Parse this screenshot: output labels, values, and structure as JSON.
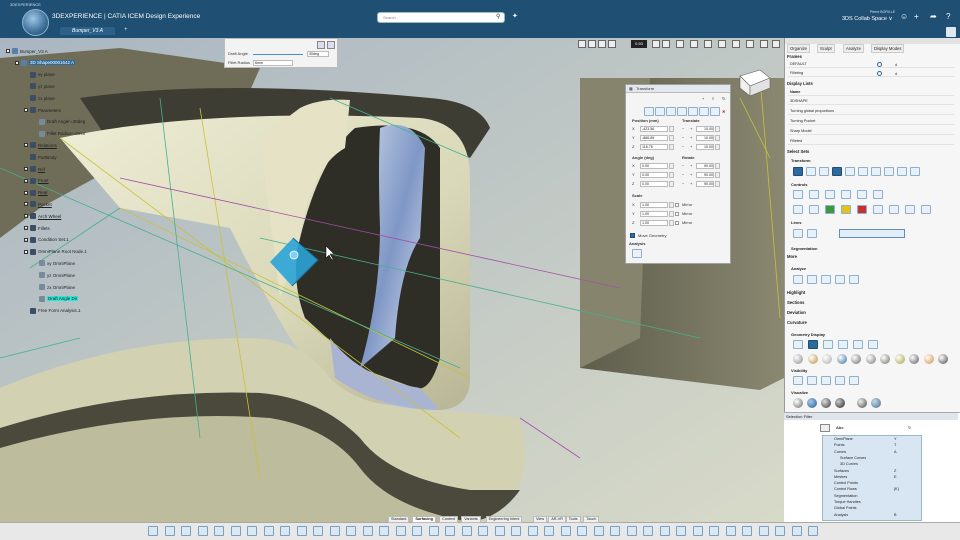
{
  "window": {
    "caption": "3DEXPERIENCE",
    "app_title": "3DEXPERIENCE | CATIA  ICEM Design Experience",
    "tab": "Bumper_V3 A",
    "new_tab": "+"
  },
  "search": {
    "placeholder": "Search"
  },
  "user": {
    "name": "Pierre BORILLE",
    "space": "3DS Collab Space ∨"
  },
  "tree": [
    {
      "label": "Bumper_V3 A",
      "indent": 0,
      "expand": "-"
    },
    {
      "label": "3D Shape00001642 A",
      "indent": 1,
      "expand": "-",
      "selected": true
    },
    {
      "label": "xy plane",
      "indent": 2
    },
    {
      "label": "yz plane",
      "indent": 2
    },
    {
      "label": "zx plane",
      "indent": 2
    },
    {
      "label": "Parameters",
      "indent": 2,
      "expand": "-"
    },
    {
      "label": "Draft Angle'=30deg",
      "indent": 3
    },
    {
      "label": "Fillet Radius'=6mm",
      "indent": 3
    },
    {
      "label": "Relations",
      "indent": 2,
      "expand": "+"
    },
    {
      "label": "PartBody",
      "indent": 2
    },
    {
      "label": "Ref",
      "indent": 2,
      "expand": "+"
    },
    {
      "label": "Front",
      "indent": 2,
      "expand": "+"
    },
    {
      "label": "Rear",
      "indent": 2,
      "expand": "+"
    },
    {
      "label": "Pocket",
      "indent": 2,
      "expand": "+"
    },
    {
      "label": "Arch Wheel",
      "indent": 2,
      "expand": "+"
    },
    {
      "label": "Fillets",
      "indent": 2,
      "expand": "+"
    },
    {
      "label": "Condition Set.1",
      "indent": 2,
      "expand": "+"
    },
    {
      "label": "OmniPlane Root Node.1",
      "indent": 2,
      "expand": "-"
    },
    {
      "label": "xy OmniPlane",
      "indent": 3
    },
    {
      "label": "yz OmniPlane",
      "indent": 3
    },
    {
      "label": "zx OmniPlane",
      "indent": 3
    },
    {
      "label": "Draft Angle Dir",
      "indent": 3,
      "highlight": true
    },
    {
      "label": "Free Form Analysis.1",
      "indent": 2
    }
  ],
  "draft_panel": {
    "draft_label": "Draft Angle",
    "draft_value": "30deg",
    "fillet_label": "Fillet Radius",
    "fillet_value": "6mm"
  },
  "view": {
    "zoom": "0.93"
  },
  "transform": {
    "title": "Transform",
    "position_header": "Position (mm)",
    "translate_header": "Translate",
    "position": [
      {
        "axis": "X",
        "value": "-423.56"
      },
      {
        "axis": "Y",
        "value": "-866.89"
      },
      {
        "axis": "Z",
        "value": "116.76"
      }
    ],
    "translate": [
      "10.00",
      "10.00",
      "10.00"
    ],
    "angle_header": "Angle (deg)",
    "rotate_header": "Rotate",
    "angle": [
      {
        "axis": "X",
        "value": "0.00"
      },
      {
        "axis": "Y",
        "value": "0.00"
      },
      {
        "axis": "Z",
        "value": "0.00"
      }
    ],
    "rotate": [
      "90.00",
      "90.00",
      "90.00"
    ],
    "scale_header": "Scale",
    "scale": [
      {
        "axis": "X",
        "value": "1.00"
      },
      {
        "axis": "Y",
        "value": "1.00"
      },
      {
        "axis": "Z",
        "value": "1.00"
      }
    ],
    "mirror_label": "Mirror",
    "move_geometry": "Move Geometry",
    "analysis_header": "Analysis"
  },
  "right_panel": {
    "tabs": [
      "Organize",
      "Sculpt",
      "Analyze",
      "Display Modes"
    ],
    "frames_header": "Frames",
    "frames": [
      {
        "name": "DEFAULT",
        "type": "d"
      },
      {
        "name": "Filleting",
        "type": "d"
      }
    ],
    "display_lists_header": "Display Lists",
    "dl_col_name": "Name",
    "display_lists": [
      "3DSHAPE",
      "Turning global proportions",
      "Turning Pocket",
      "Sharp Model",
      "Filleted"
    ],
    "select_sets": "Select Sets",
    "transform": "Transform",
    "controls": "Controls",
    "lines": "Lines",
    "segmentation": "Segmentation",
    "more": "More",
    "analyze": "Analyze",
    "highlight": "Highlight",
    "sections": "Sections",
    "deviation": "Deviation",
    "curvature": "Curvature",
    "geometry_display": "Geometry Display",
    "visibility": "Visibility",
    "visualize": "Visualize"
  },
  "selection_filter": {
    "title": "Selection Filter",
    "mode_label": "Abc",
    "items": [
      {
        "name": "OmniPlane",
        "key": "Y"
      },
      {
        "name": "Points",
        "key": "T"
      },
      {
        "name": "Curves",
        "key": "A"
      },
      {
        "name": "Surface Curves",
        "key": ""
      },
      {
        "name": "3D Curves",
        "key": ""
      },
      {
        "name": "Surfaces",
        "key": "Z"
      },
      {
        "name": "Meshes",
        "key": "E"
      },
      {
        "name": "Control Points",
        "key": ""
      },
      {
        "name": "Control Rows",
        "key": "[K]"
      },
      {
        "name": "Segmentation",
        "key": ""
      },
      {
        "name": "Torque Handles",
        "key": ""
      },
      {
        "name": "Global Points",
        "key": ""
      },
      {
        "name": "Analysis",
        "key": "B"
      }
    ]
  },
  "bottom_tabs": [
    "Standard",
    "Surfacing",
    "Context",
    "Variants",
    "Engineering Intent",
    "View",
    "AR-VR",
    "Tools",
    "Touch"
  ],
  "bottom_active": "Surfacing",
  "colors": {
    "topbar": "#1f4f73",
    "accent": "#2e6a9e",
    "selection": "#3aa0d0",
    "tree_highlight": "#2ee6d6"
  }
}
